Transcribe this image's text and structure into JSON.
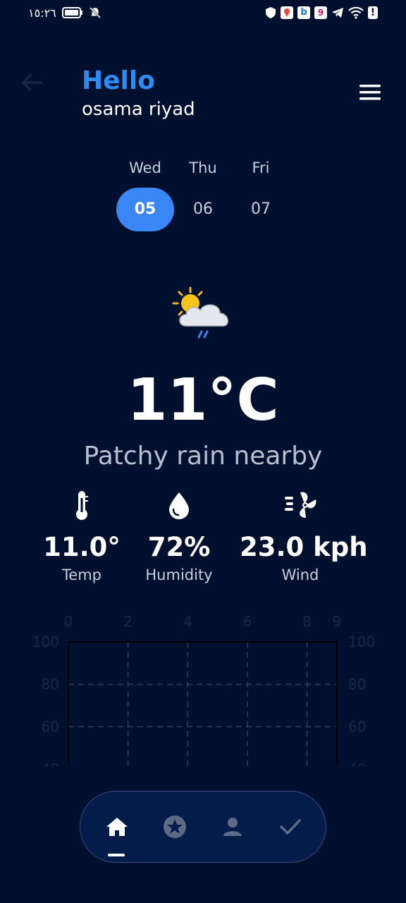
{
  "status_bar": {
    "time": "١٥:٢٦"
  },
  "header": {
    "greeting": "Hello",
    "user_name": "osama riyad"
  },
  "days": [
    {
      "name": "Wed",
      "number": "05",
      "selected": true
    },
    {
      "name": "Thu",
      "number": "06",
      "selected": false
    },
    {
      "name": "Fri",
      "number": "07",
      "selected": false
    }
  ],
  "weather": {
    "icon": "partly-cloudy-rain-icon",
    "temperature": "11°C",
    "condition": "Patchy rain nearby"
  },
  "stats": [
    {
      "icon": "thermometer-icon",
      "value": "11.0°",
      "label": "Temp"
    },
    {
      "icon": "water-drop-icon",
      "value": "72%",
      "label": "Humidity"
    },
    {
      "icon": "wind-fan-icon",
      "value": "23.0 kph",
      "label": "Wind"
    }
  ],
  "chart_data": {
    "type": "line",
    "x_ticks": [
      "0",
      "2",
      "4",
      "6",
      "8",
      "9"
    ],
    "y_ticks": [
      "100",
      "80",
      "60"
    ],
    "xlim": [
      0,
      9
    ],
    "ylim_visible": [
      60,
      100
    ],
    "grid": true,
    "series": []
  },
  "nav": {
    "items": [
      {
        "icon": "home-icon",
        "active": true
      },
      {
        "icon": "star-badge-icon",
        "active": false
      },
      {
        "icon": "person-icon",
        "active": false
      },
      {
        "icon": "checkmark-icon",
        "active": false
      }
    ]
  },
  "colors": {
    "background": "#02102f",
    "accent": "#3b86f5",
    "greeting": "#2e8bf0",
    "nav_background": "#031c4a"
  }
}
